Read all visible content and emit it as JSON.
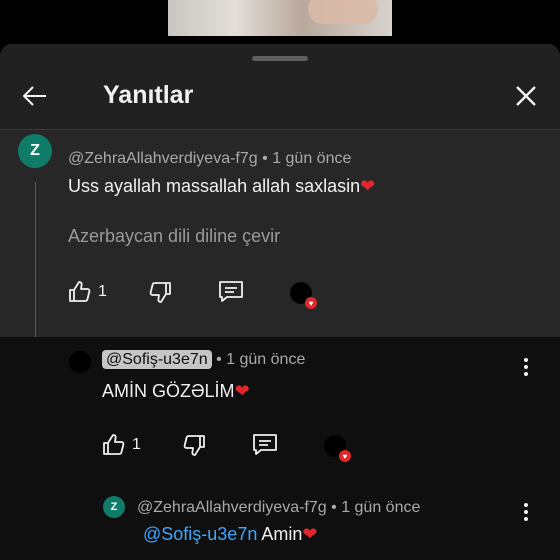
{
  "header": {
    "title": "Yanıtlar"
  },
  "parent_comment": {
    "avatar_letter": "Z",
    "avatar_color": "#0f7c6a",
    "author": "@ZehraAllahverdiyeva-f7g",
    "separator": "•",
    "time": "1 gün önce",
    "text": "Uss ayallah massallah allah saxlasin",
    "emoji": "❤",
    "translate": "Azerbaycan dili diline çevir",
    "likes": "1"
  },
  "reply_1": {
    "author": "@Sofiş-u3e7n",
    "separator": "•",
    "time": "1 gün önce",
    "text": "AMİN GÖZƏLİM",
    "emoji": "❤",
    "likes": "1"
  },
  "reply_2": {
    "avatar_letter": "Z",
    "avatar_color": "#0f7c6a",
    "author": "@ZehraAllahverdiyeva-f7g",
    "separator": "•",
    "time": "1 gün önce",
    "mention": "@Sofiş-u3e7n",
    "text": " Amin",
    "emoji": "❤"
  },
  "colors": {
    "sheet_bg": "#212121",
    "highlight_bg": "#272727",
    "accent_link": "#3ea6ff",
    "heart": "#e0272b"
  }
}
